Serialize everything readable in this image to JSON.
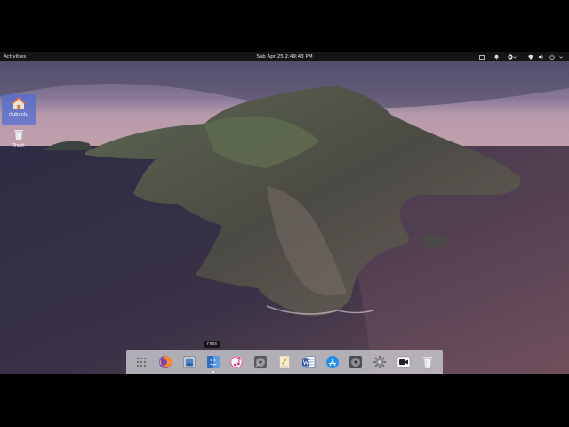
{
  "topbar": {
    "activities_label": "Activities",
    "clock": "Sab Apr 25   2:49:43 PM",
    "tray_icons": [
      "screen-icon",
      "notification-icon",
      "accessibility-icon",
      "network-icon",
      "volume-icon",
      "power-icon"
    ]
  },
  "desktop": {
    "home_label": "rtubuntu",
    "trash_label": "Trash"
  },
  "dock": {
    "tooltip": "Files",
    "items": [
      {
        "name": "show-applications"
      },
      {
        "name": "firefox"
      },
      {
        "name": "image-viewer"
      },
      {
        "name": "files"
      },
      {
        "name": "music"
      },
      {
        "name": "disk-utility"
      },
      {
        "name": "text-editor"
      },
      {
        "name": "word"
      },
      {
        "name": "app-store"
      },
      {
        "name": "disk-utility-2"
      },
      {
        "name": "settings"
      },
      {
        "name": "screen-recorder"
      },
      {
        "name": "trash"
      }
    ]
  },
  "colors": {
    "accent": "#4a6fd8",
    "topbar": "#151515",
    "dock": "#c8c8cd"
  }
}
